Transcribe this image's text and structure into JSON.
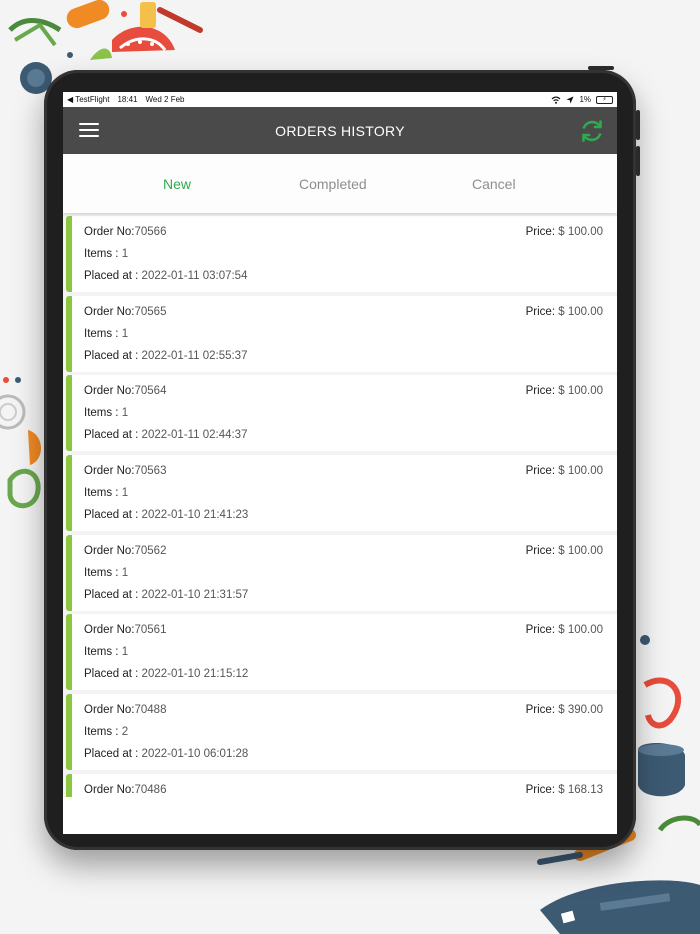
{
  "status_bar": {
    "back_app": "◀ TestFlight",
    "time": "18:41",
    "date": "Wed 2 Feb",
    "wifi_icon": "wifi-icon",
    "location_icon": "location-arrow-icon",
    "battery_percent": "1%"
  },
  "header": {
    "title": "ORDERS HISTORY",
    "menu_icon": "hamburger-menu-icon",
    "refresh_icon": "refresh-icon"
  },
  "tabs": [
    {
      "label": "New",
      "active": true
    },
    {
      "label": "Completed",
      "active": false
    },
    {
      "label": "Cancel",
      "active": false
    }
  ],
  "labels": {
    "order_no": "Order No:",
    "items": "Items :",
    "placed_at": "Placed at :",
    "price": "Price:"
  },
  "orders": [
    {
      "order_no": "70566",
      "items": "1",
      "placed_at": "2022-01-11 03:07:54",
      "price": "$ 100.00"
    },
    {
      "order_no": "70565",
      "items": "1",
      "placed_at": "2022-01-11 02:55:37",
      "price": "$ 100.00"
    },
    {
      "order_no": "70564",
      "items": "1",
      "placed_at": "2022-01-11 02:44:37",
      "price": "$ 100.00"
    },
    {
      "order_no": "70563",
      "items": "1",
      "placed_at": "2022-01-10 21:41:23",
      "price": "$ 100.00"
    },
    {
      "order_no": "70562",
      "items": "1",
      "placed_at": "2022-01-10 21:31:57",
      "price": "$ 100.00"
    },
    {
      "order_no": "70561",
      "items": "1",
      "placed_at": "2022-01-10 21:15:12",
      "price": "$ 100.00"
    },
    {
      "order_no": "70488",
      "items": "2",
      "placed_at": "2022-01-10 06:01:28",
      "price": "$ 390.00"
    },
    {
      "order_no": "70486",
      "items": "",
      "placed_at": "",
      "price": "$ 168.13"
    }
  ],
  "colors": {
    "header_bg": "#4a4a4a",
    "accent_green": "#2eaa4f",
    "order_bar_green": "#8cc63f",
    "tablet_frame": "#1f1f1f"
  }
}
